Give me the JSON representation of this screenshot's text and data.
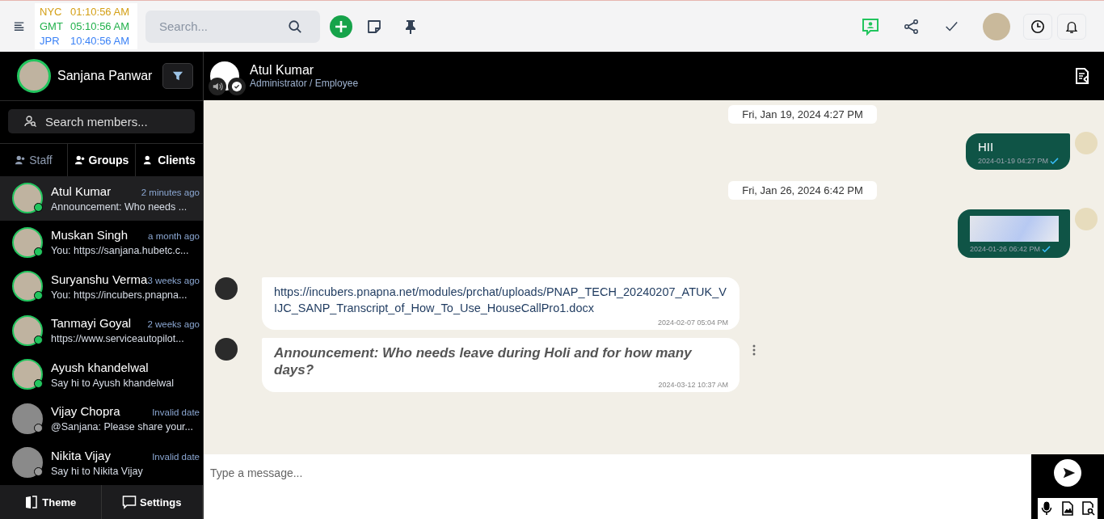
{
  "topbar": {
    "clocks": [
      {
        "zone": "NYC",
        "time": "01:10:56 AM",
        "color": "#d4a017"
      },
      {
        "zone": "GMT",
        "time": "05:10:56 AM",
        "color": "#22b14c"
      },
      {
        "zone": "JPR",
        "time": "10:40:56 AM",
        "color": "#3b82f6"
      }
    ],
    "search": {
      "placeholder": "Search..."
    }
  },
  "sidebar": {
    "user": {
      "name": "Sanjana Panwar"
    },
    "search": {
      "placeholder": "Search members..."
    },
    "tabs": [
      {
        "label": "Staff",
        "selected": true
      },
      {
        "label": "Groups",
        "selected": false
      },
      {
        "label": "Clients",
        "selected": false
      }
    ],
    "contacts": [
      {
        "name": "Atul Kumar",
        "time": "2 minutes ago",
        "preview": "Announcement: Who needs ...",
        "online": true,
        "selected": true
      },
      {
        "name": "Muskan Singh",
        "time": "a month ago",
        "preview": "You: https://sanjana.hubetc.c...",
        "online": true,
        "selected": false
      },
      {
        "name": "Suryanshu Verma",
        "time": "3 weeks ago",
        "preview": "You: https://incubers.pnapna...",
        "online": true,
        "selected": false
      },
      {
        "name": "Tanmayi Goyal",
        "time": "2 weeks ago",
        "preview": "https://www.serviceautopilot...",
        "online": true,
        "selected": false
      },
      {
        "name": "Ayush khandelwal",
        "preview": "Say hi to Ayush khandelwal",
        "online": true,
        "selected": false
      },
      {
        "name": "Vijay Chopra",
        "time": "Invalid date",
        "preview": "@Sanjana: Please share your...",
        "online": false,
        "selected": false
      },
      {
        "name": "Nikita Vijay",
        "time": "Invalid date",
        "preview": "Say hi to Nikita Vijay",
        "online": false,
        "selected": false
      }
    ],
    "footer": [
      {
        "label": "Theme",
        "kind": "theme"
      },
      {
        "label": "Settings",
        "kind": "settings"
      }
    ]
  },
  "chat": {
    "contact": {
      "name": "Atul Kumar",
      "role": "Administrator / Employee"
    },
    "messages": [
      {
        "kind": "date",
        "text": "Fri, Jan 19, 2024 4:27 PM"
      },
      {
        "kind": "outgoing-text",
        "text": "HII",
        "time": "2024-01-19 04:27 PM"
      },
      {
        "kind": "date",
        "text": "Fri, Jan 26, 2024 6:42 PM"
      },
      {
        "kind": "outgoing-image",
        "time": "2024-01-26 06:42 PM"
      },
      {
        "kind": "incoming-text",
        "text": "https://incubers.pnapna.net/modules/prchat/uploads/PNAP_TECH_20240207_ATUK_VIJC_SANP_Transcript_of_How_To_Use_HouseCallPro1.docx",
        "time": "2024-02-07 05:04 PM"
      },
      {
        "kind": "incoming-announcement",
        "text": "Announcement:  Who needs leave during Holi and for how many days?",
        "time": "2024-03-12 10:37 AM"
      }
    ],
    "composer": {
      "placeholder": "Type a message..."
    }
  }
}
